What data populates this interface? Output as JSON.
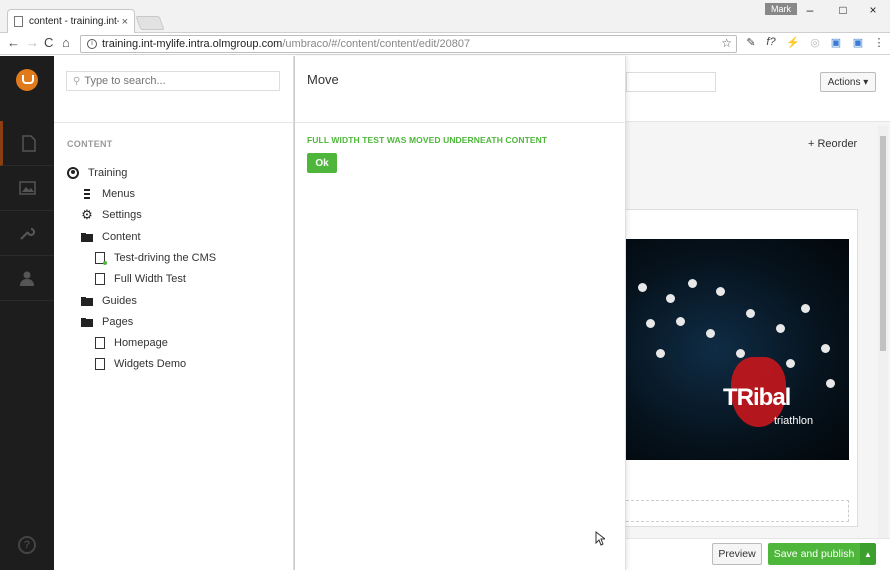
{
  "browser": {
    "tab_title": "content - training.int-my",
    "tab_close": "×",
    "user": "Mark",
    "url_host": "training.int-mylife.intra.olmgroup.com",
    "url_path": "/umbraco/#/content/content/edit/20807",
    "win_controls": [
      "–",
      "□",
      "×"
    ],
    "nav_icons": [
      "←",
      "→",
      "C",
      "⌂"
    ],
    "extensions": [
      "✎",
      "f?",
      "⚡",
      "◎",
      "▣",
      "▣",
      "⋮"
    ]
  },
  "tree": {
    "search_placeholder": "Type to search...",
    "section_title": "CONTENT",
    "items": [
      {
        "label": "Training",
        "icon": "globe-icon"
      },
      {
        "label": "Menus",
        "icon": "menu-icon"
      },
      {
        "label": "Settings",
        "icon": "gear-icon"
      },
      {
        "label": "Content",
        "icon": "folder-icon"
      },
      {
        "label": "Test-driving the CMS",
        "icon": "document-icon"
      },
      {
        "label": "Full Width Test",
        "icon": "document-icon"
      },
      {
        "label": "Guides",
        "icon": "folder-icon"
      },
      {
        "label": "Pages",
        "icon": "folder-icon"
      },
      {
        "label": "Homepage",
        "icon": "document-icon"
      },
      {
        "label": "Widgets Demo",
        "icon": "document-icon"
      }
    ]
  },
  "dialog": {
    "title": "Move",
    "message": "FULL WIDTH TEST WAS MOVED UNDERNEATH CONTENT",
    "ok_label": "Ok"
  },
  "editor": {
    "actions_label": "Actions ▾",
    "reorder_label": "Reorder",
    "image_brand": "TRibal",
    "image_sub": "triathlon",
    "preview_label": "Preview",
    "publish_label": "Save and publish",
    "publish_caret": "▲"
  },
  "colors": {
    "accent_green": "#4eb73b",
    "nav_dark": "#1d1d1d",
    "logo_orange": "#e07b1c"
  }
}
